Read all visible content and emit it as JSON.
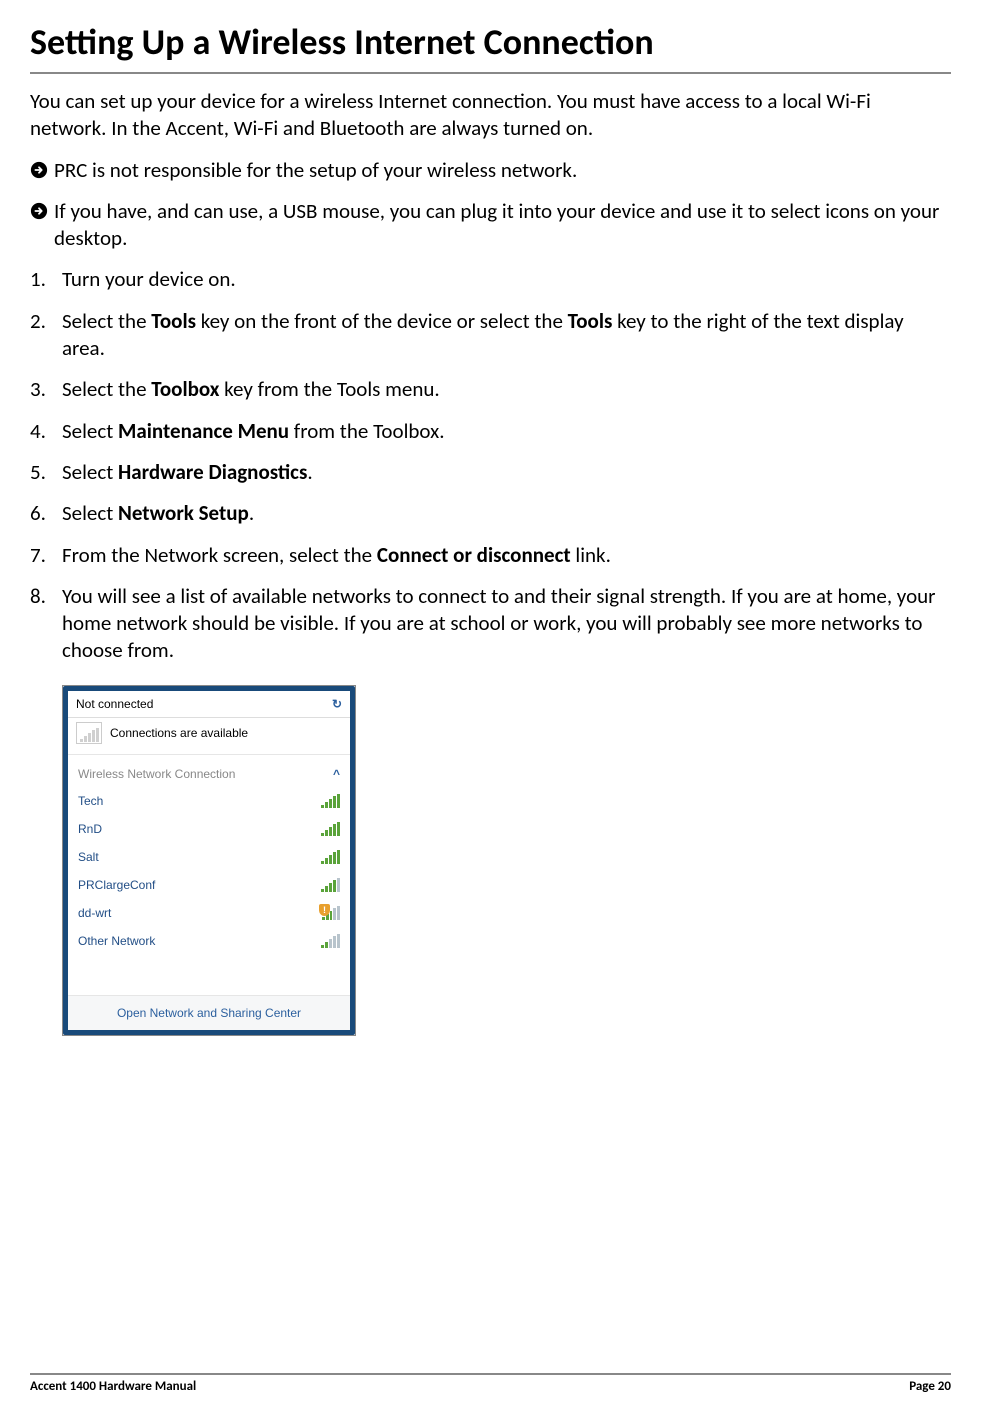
{
  "title": "Setting Up a Wireless Internet Connection",
  "intro": "You can set up your device for a wireless Internet connection. You must have access to a local Wi-Fi network. In the Accent, Wi-Fi and Bluetooth are always turned on.",
  "notes": [
    "PRC is not responsible for the setup of your wireless network.",
    "If you have, and can use, a USB mouse, you can plug it into your device and use it to select icons on your desktop."
  ],
  "steps": {
    "s1": "Turn your device on.",
    "s2_a": "Select the ",
    "s2_b": "Tools",
    "s2_c": " key on the front of the device or select the ",
    "s2_d": "Tools",
    "s2_e": " key to the right of the text display area.",
    "s3_a": "Select the ",
    "s3_b": "Toolbox",
    "s3_c": " key from the Tools menu.",
    "s4_a": "Select ",
    "s4_b": "Maintenance Menu",
    "s4_c": " from the Toolbox.",
    "s5_a": "Select ",
    "s5_b": "Hardware Diagnostics",
    "s5_c": ".",
    "s6_a": "Select ",
    "s6_b": "Network Setup",
    "s6_c": ".",
    "s7_a": "From the Network screen, select the ",
    "s7_b": "Connect or disconnect",
    "s7_c": " link.",
    "s8": "You will see a list of available networks to connect to and their signal strength. If you are at home, your home network should be visible. If you are at school or work, you will probably see more networks to choose from."
  },
  "wifi": {
    "header": "Not connected",
    "status_text": "Connections are available",
    "section_label": "Wireless Network Connection",
    "networks": [
      {
        "name": "Tech",
        "bars_on": 5,
        "shield": false
      },
      {
        "name": "RnD",
        "bars_on": 5,
        "shield": false
      },
      {
        "name": "Salt",
        "bars_on": 5,
        "shield": false
      },
      {
        "name": "PRClargeConf",
        "bars_on": 4,
        "shield": false
      },
      {
        "name": "dd-wrt",
        "bars_on": 3,
        "shield": true
      },
      {
        "name": "Other Network",
        "bars_on": 2,
        "shield": false
      }
    ],
    "footer": "Open Network and Sharing Center"
  },
  "footer": {
    "left": "Accent 1400 Hardware Manual",
    "right": "Page 20"
  }
}
